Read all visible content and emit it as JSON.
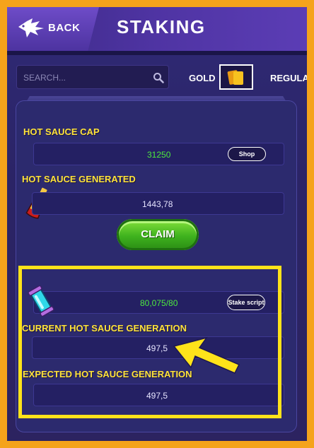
{
  "header": {
    "back_label": "BACK",
    "title": "STAKING"
  },
  "filters": {
    "search_placeholder": "SEARCH...",
    "tab_gold": "GOLD",
    "tab_regular": "REGULA"
  },
  "panel": {
    "cap": {
      "label": "HOT SAUCE CAP",
      "value": "31250",
      "shop_label": "Shop"
    },
    "generated": {
      "label": "HOT SAUCE GENERATED",
      "value": "1443,78"
    },
    "claim_label": "CLAIM",
    "stake": {
      "value": "80,075/80",
      "stake_label": "Stake script"
    },
    "current": {
      "label": "CURRENT HOT SAUCE GENERATION",
      "value": "497,5"
    },
    "expected": {
      "label": "EXPECTED HOT SAUCE GENERATION",
      "value": "497,5"
    }
  },
  "colors": {
    "frame": "#f5a31b",
    "accent_yellow": "#ffe31a",
    "value_green": "#4dea3d"
  },
  "icons": [
    "fish-icon",
    "search-icon",
    "cards-icon",
    "hot-sauce-bottle-icon",
    "crystal-vial-icon",
    "arrow-pointer-icon"
  ]
}
